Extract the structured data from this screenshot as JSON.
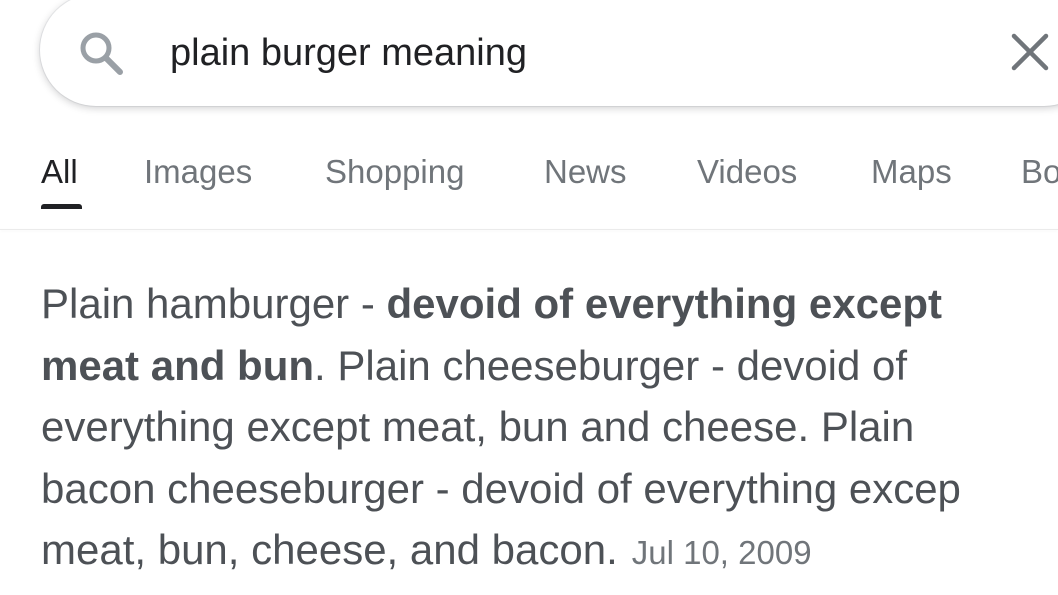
{
  "search": {
    "query": "plain burger meaning"
  },
  "tabs": [
    {
      "label": "All"
    },
    {
      "label": "Images"
    },
    {
      "label": "Shopping"
    },
    {
      "label": "News"
    },
    {
      "label": "Videos"
    },
    {
      "label": "Maps"
    },
    {
      "label": "Bo"
    }
  ],
  "active_tab": "All",
  "snippet": {
    "line1_plain": "Plain hamburger - ",
    "line1_bold": "devoid of everything except",
    "line2_bold": "meat and bun",
    "line2_plain": ". Plain cheeseburger - devoid of",
    "line3": "everything except meat, bun and cheese. Plain",
    "line4": "bacon cheeseburger - devoid of everything excep",
    "line5": "meat, bun, cheese, and bacon.",
    "date": "Jul 10, 2009"
  },
  "colors": {
    "text_primary": "#202124",
    "text_secondary": "#70757a",
    "snippet_text": "#4d5156",
    "icon": "#70757a"
  }
}
